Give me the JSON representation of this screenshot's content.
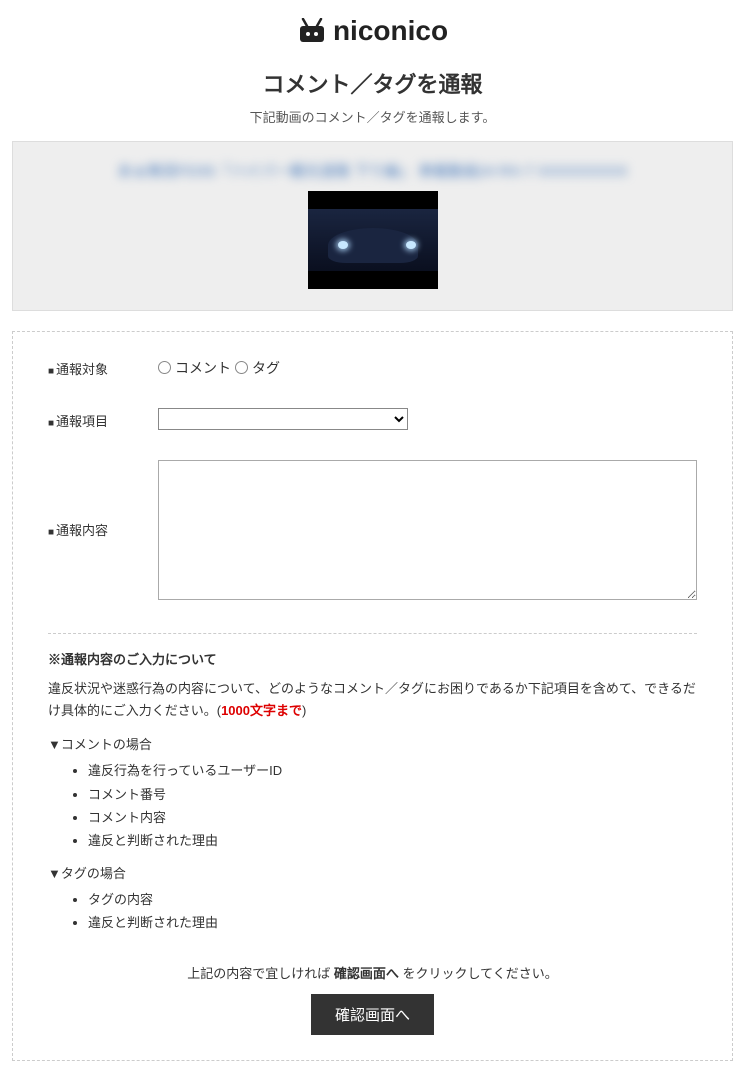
{
  "brand": "niconico",
  "header": {
    "title": "コメント／タグを通報",
    "subtitle": "下記動画のコメント／タグを通報します。"
  },
  "video": {
    "title_blurred": "あぁ無双FD3S「ハイパー観光道路 下り編」 車載動画24 RX-7 XXXXXXXXX"
  },
  "form": {
    "target_label": "通報対象",
    "target_options": [
      "コメント",
      "タグ"
    ],
    "category_label": "通報項目",
    "content_label": "通報内容"
  },
  "notice": {
    "title": "※通報内容のご入力について",
    "text_before": "違反状況や迷惑行為の内容について、どのようなコメント／タグにお困りであるか下記項目を含めて、できるだけ具体的にご入力ください。(",
    "limit": "1000文字まで",
    "text_after": ")",
    "heading_comment": "▼コメントの場合",
    "list_comment": [
      "違反行為を行っているユーザーID",
      "コメント番号",
      "コメント内容",
      "違反と判断された理由"
    ],
    "heading_tag": "▼タグの場合",
    "list_tag": [
      "タグの内容",
      "違反と判断された理由"
    ]
  },
  "submit": {
    "note_before": "上記の内容で宜しければ ",
    "note_bold": "確認画面へ",
    "note_after": " をクリックしてください。",
    "button": "確認画面へ"
  }
}
